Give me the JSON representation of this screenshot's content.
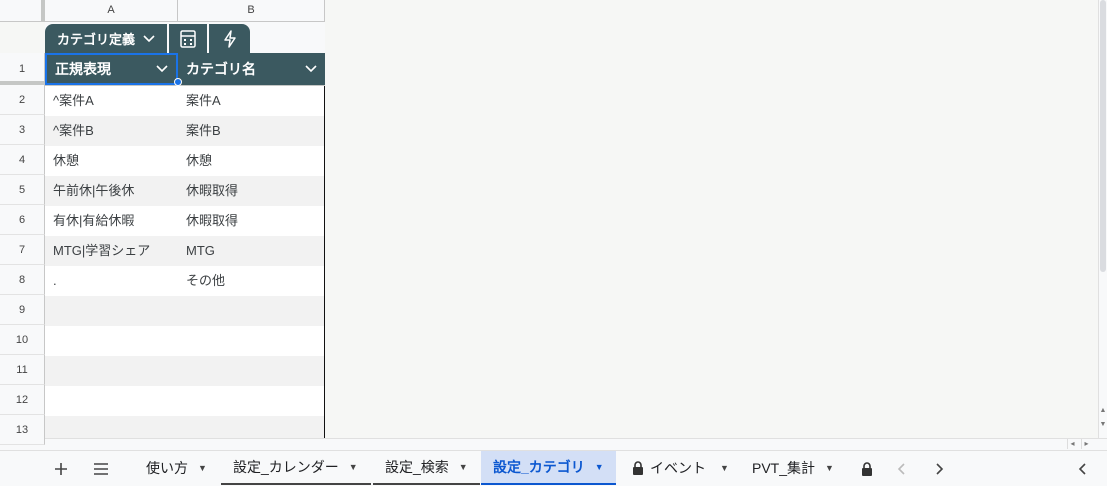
{
  "columns": {
    "a": "A",
    "b": "B"
  },
  "table": {
    "name": "カテゴリ定義",
    "headers": {
      "a": "正規表現",
      "b": "カテゴリ名"
    },
    "rows": [
      {
        "a": "^案件A",
        "b": "案件A"
      },
      {
        "a": "^案件B",
        "b": "案件B"
      },
      {
        "a": "休憩",
        "b": "休憩"
      },
      {
        "a": "午前休|午後休",
        "b": "休暇取得"
      },
      {
        "a": "有休|有給休暇",
        "b": "休暇取得"
      },
      {
        "a": "MTG|学習シェア",
        "b": "MTG"
      },
      {
        "a": ".",
        "b": "その他"
      },
      {
        "a": "",
        "b": ""
      },
      {
        "a": "",
        "b": ""
      },
      {
        "a": "",
        "b": ""
      },
      {
        "a": "",
        "b": ""
      },
      {
        "a": "",
        "b": ""
      }
    ]
  },
  "row_numbers": [
    "1",
    "2",
    "3",
    "4",
    "5",
    "6",
    "7",
    "8",
    "9",
    "10",
    "11",
    "12",
    "13"
  ],
  "sheet_tabs": [
    {
      "label": "使い方"
    },
    {
      "label": "設定_カレンダー"
    },
    {
      "label": "設定_検索"
    },
    {
      "label": "設定_カテゴリ",
      "active": true
    },
    {
      "label": "イベント",
      "locked": true
    },
    {
      "label": "PVT_集計"
    }
  ],
  "icons": {
    "add_sheet": "plus-icon",
    "all_sheets": "menu-icon",
    "calc": "calculator-icon",
    "bolt": "lightning-icon",
    "lock": "lock-icon"
  },
  "colors": {
    "table_header": "#3b5960",
    "active_tab_bg": "#d3dff6",
    "active_tab_text": "#0b57d0",
    "selection": "#1a73e8"
  }
}
